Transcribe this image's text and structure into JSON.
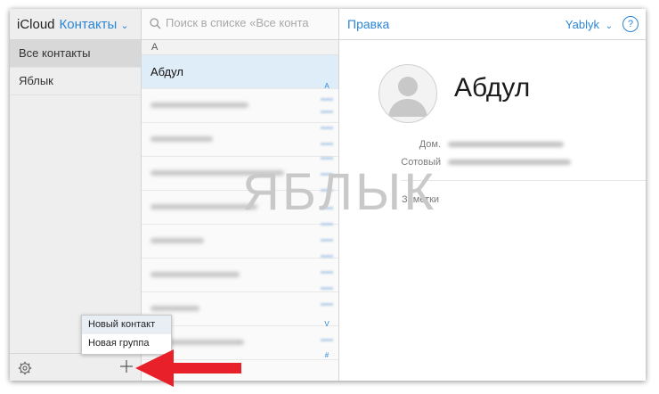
{
  "sidebar": {
    "app_name": "iCloud",
    "section_label": "Контакты",
    "section_chevron": "chevron-down-icon",
    "groups": [
      {
        "label": "Все контакты",
        "selected": true
      },
      {
        "label": "Яблык",
        "selected": false
      }
    ],
    "footer_icons": [
      "gear-icon",
      "plus-icon"
    ]
  },
  "popup_menu": {
    "items": [
      {
        "label": "Новый контакт",
        "highlighted": true
      },
      {
        "label": "Новая группа",
        "highlighted": false
      }
    ]
  },
  "contact_list": {
    "search_placeholder": "Поиск в списке «Все конта",
    "section_header": "А",
    "selected_contact": "Абдул",
    "index_letters": [
      "А",
      "V",
      "#"
    ]
  },
  "detail": {
    "edit_label": "Правка",
    "user_menu_label": "Yablyk",
    "help_label": "?",
    "contact_name": "Абдул",
    "fields": [
      {
        "label": "Дом."
      },
      {
        "label": "Сотовый"
      }
    ],
    "notes_label": "Заметки"
  },
  "watermark": {
    "text": "ЯБЛЫК"
  },
  "colors": {
    "accent": "#2b86d6",
    "sidebar_bg": "#eeeeee",
    "selected_row": "#dfedf8",
    "arrow": "#e8202a"
  }
}
